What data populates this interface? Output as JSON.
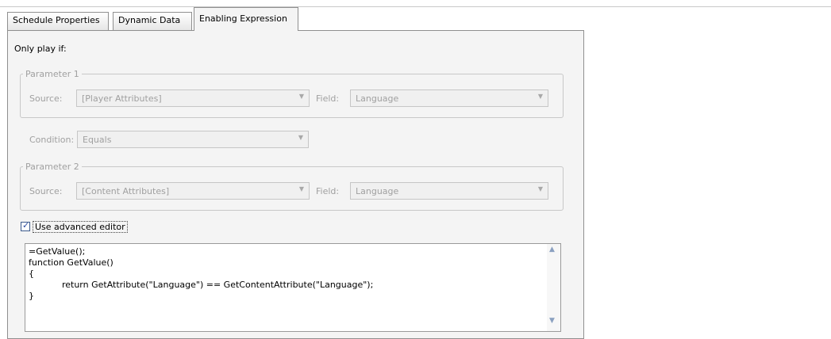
{
  "tabs": [
    {
      "label": "Schedule Properties"
    },
    {
      "label": "Dynamic Data"
    },
    {
      "label": "Enabling Expression"
    }
  ],
  "only_play_label": "Only play if:",
  "parameter1": {
    "legend": "Parameter 1",
    "source_label": "Source:",
    "source_value": "[Player Attributes]",
    "field_label": "Field:",
    "field_value": "Language"
  },
  "condition": {
    "label": "Condition:",
    "value": "Equals"
  },
  "parameter2": {
    "legend": "Parameter 2",
    "source_label": "Source:",
    "source_value": "[Content Attributes]",
    "field_label": "Field:",
    "field_value": "Language"
  },
  "advanced_editor": {
    "label": "Use advanced editor",
    "checked": true
  },
  "editor": {
    "code": "=GetValue();\nfunction GetValue()\n{\n            return GetAttribute(\"Language\") == GetContentAttribute(\"Language\");\n}"
  },
  "icons": {
    "dropdown": "chevron-down-icon",
    "scroll_up": "scroll-up-arrow-icon",
    "scroll_down": "scroll-down-arrow-icon",
    "check": "checkmark-icon"
  }
}
